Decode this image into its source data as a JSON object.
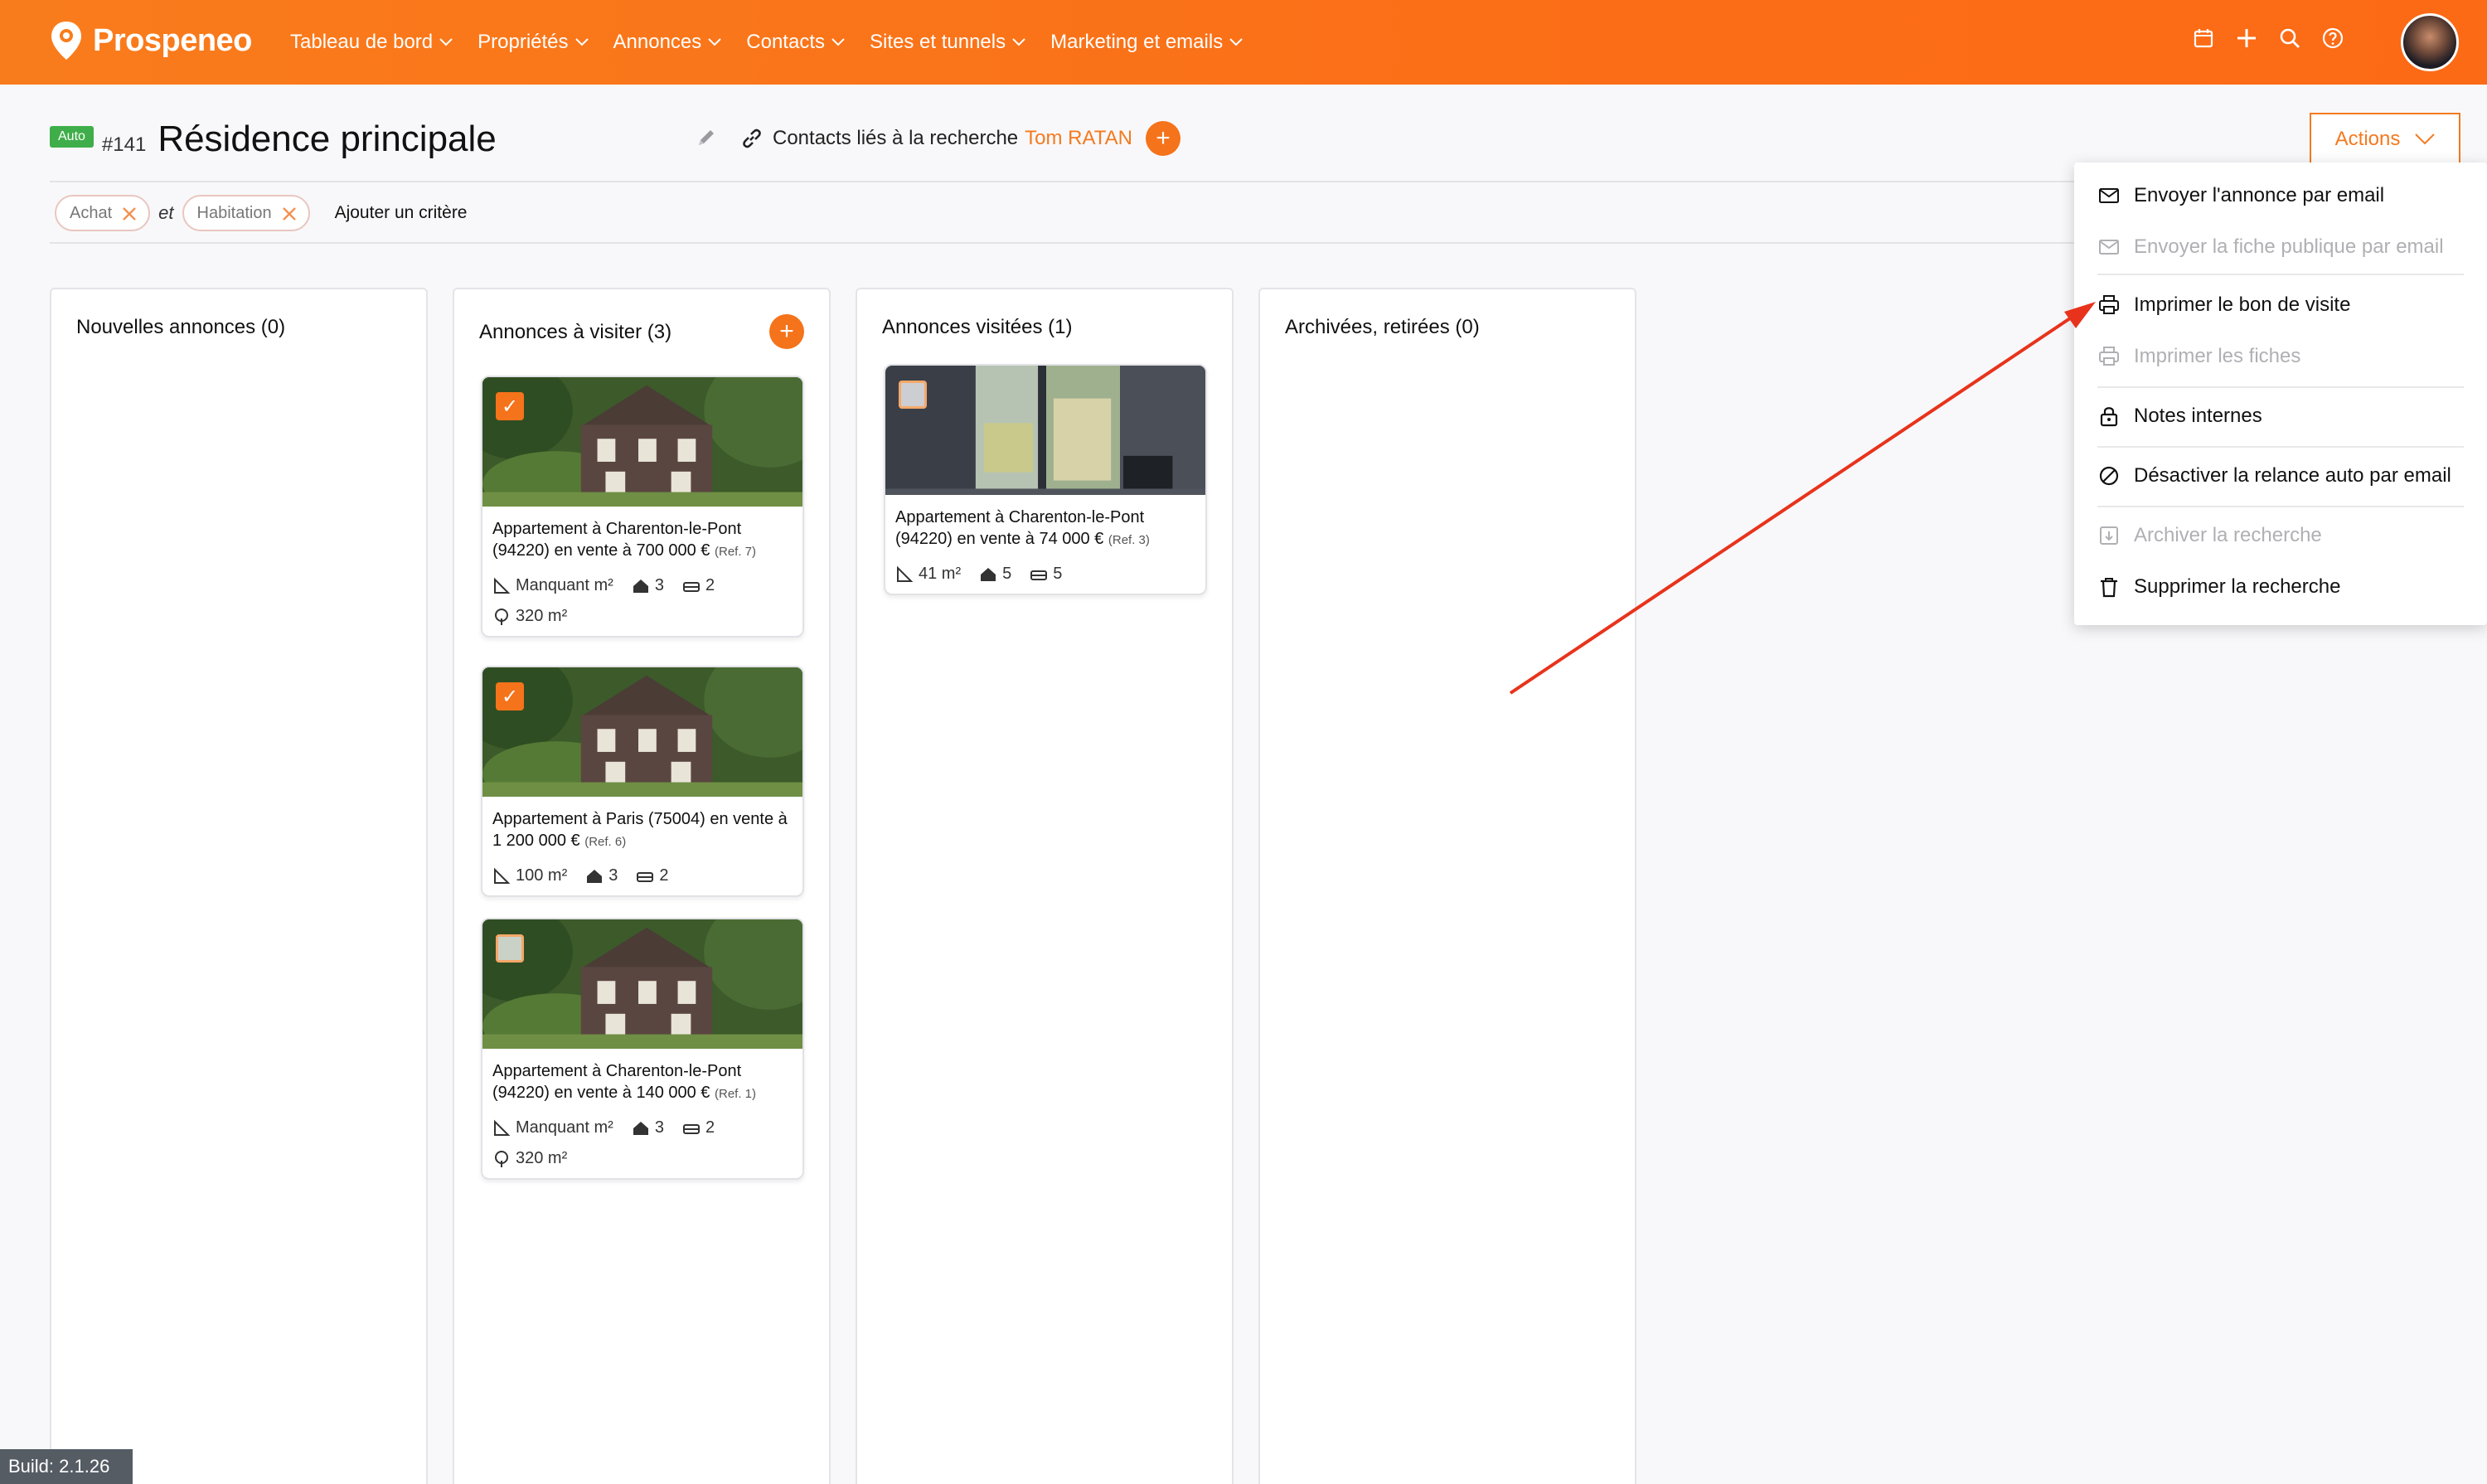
{
  "app": {
    "brand": "Prospeneo",
    "brand_color": "#f97c1c",
    "build": "Build: 2.1.26"
  },
  "nav": {
    "items": [
      "Tableau de bord",
      "Propriétés",
      "Annonces",
      "Contacts",
      "Sites et tunnels",
      "Marketing et emails"
    ],
    "icons": [
      "calendar-icon",
      "plus-icon",
      "search-icon",
      "help-icon"
    ]
  },
  "search": {
    "badge": "Auto",
    "id": "#141",
    "title": "Résidence principale",
    "contacts_label": "Contacts liés à la recherche",
    "contact_name": "Tom RATAN",
    "add_symbol": "+",
    "actions_label": "Actions"
  },
  "criteria": {
    "chips": [
      "Achat",
      "Habitation"
    ],
    "joiner": "et",
    "add_label": "Ajouter un critère"
  },
  "columns": [
    {
      "title": "Nouvelles annonces (0)"
    },
    {
      "title": "Annonces à visiter (3)"
    },
    {
      "title": "Annonces visitées (1)"
    },
    {
      "title": "Archivées, retirées (0)"
    }
  ],
  "cards_to_visit": [
    {
      "checked": true,
      "title": "Appartement à Charenton-le-Pont (94220) en vente à 700 000 €",
      "ref": "(Ref. 7)",
      "surface": "Manquant m²",
      "rooms": "3",
      "bedrooms": "2",
      "land": "320 m²"
    },
    {
      "checked": true,
      "title": "Appartement à Paris (75004) en vente à 1 200 000 €",
      "ref": "(Ref. 6)",
      "surface": "100 m²",
      "rooms": "3",
      "bedrooms": "2",
      "land": ""
    },
    {
      "checked": false,
      "title": "Appartement à Charenton-le-Pont (94220) en vente à 140 000 €",
      "ref": "(Ref. 1)",
      "surface": "Manquant m²",
      "rooms": "3",
      "bedrooms": "2",
      "land": "320 m²"
    }
  ],
  "cards_visited": [
    {
      "checked": false,
      "title": "Appartement à Charenton-le-Pont (94220) en vente à 74 000 €",
      "ref": "(Ref. 3)",
      "surface": "41 m²",
      "rooms": "5",
      "bedrooms": "5"
    }
  ],
  "actions_menu": [
    {
      "label": "Envoyer l'annonce par email",
      "icon": "mail-icon",
      "enabled": true
    },
    {
      "label": "Envoyer la fiche publique par email",
      "icon": "mail-icon",
      "enabled": false
    },
    {
      "label": "Imprimer le bon de visite",
      "icon": "printer-icon",
      "enabled": true
    },
    {
      "label": "Imprimer les fiches",
      "icon": "printer-icon",
      "enabled": false
    },
    {
      "label": "Notes internes",
      "icon": "lock-icon",
      "enabled": true
    },
    {
      "label": "Désactiver la relance auto par email",
      "icon": "ban-icon",
      "enabled": true
    },
    {
      "label": "Archiver la recherche",
      "icon": "archive-icon",
      "enabled": false
    },
    {
      "label": "Supprimer la recherche",
      "icon": "trash-icon",
      "enabled": true
    }
  ],
  "annotation": {
    "arrow_color": "#e8331c"
  }
}
